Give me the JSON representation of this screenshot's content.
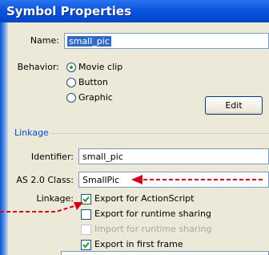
{
  "window": {
    "title": "Symbol Properties"
  },
  "name_field": {
    "label": "Name:",
    "value": "small_pic"
  },
  "behavior": {
    "label": "Behavior:",
    "options": [
      {
        "label": "Movie clip",
        "selected": true
      },
      {
        "label": "Button",
        "selected": false
      },
      {
        "label": "Graphic",
        "selected": false
      }
    ]
  },
  "edit_button": {
    "label": "Edit"
  },
  "linkage_group": {
    "title": "Linkage",
    "identifier": {
      "label": "Identifier:",
      "value": "small_pic"
    },
    "class": {
      "label": "AS 2.0 Class:",
      "value": "SmallPic"
    },
    "linkage_label": "Linkage:",
    "checkboxes": [
      {
        "label": "Export for ActionScript",
        "checked": true,
        "enabled": true
      },
      {
        "label": "Export for runtime sharing",
        "checked": false,
        "enabled": true
      },
      {
        "label": "Import for runtime sharing",
        "checked": false,
        "enabled": false
      },
      {
        "label": "Export in first frame",
        "checked": true,
        "enabled": true
      }
    ]
  },
  "colors": {
    "titlebar": "#0a55dd",
    "dialog_background": "#ece9d8",
    "selection": "#316ac5",
    "group_title": "#0046d5",
    "annotation_arrow": "#d0021b"
  }
}
